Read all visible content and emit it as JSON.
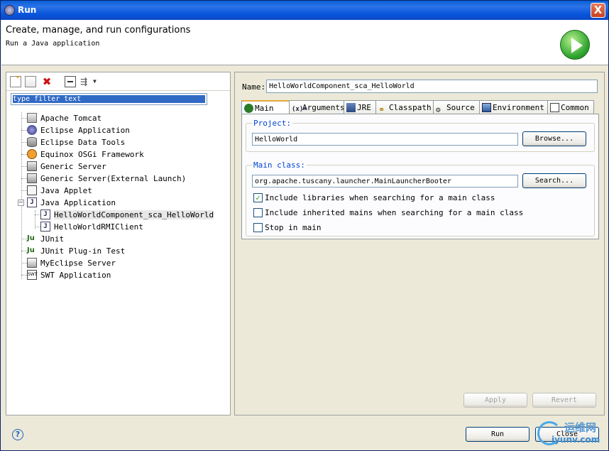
{
  "window": {
    "title": "Run",
    "close_label": "X"
  },
  "header": {
    "title": "Create, manage, and run configurations",
    "subtitle": "Run a Java application"
  },
  "left": {
    "filter_placeholder": "type filter text",
    "tree": [
      {
        "label": "Apache Tomcat",
        "icon": "tomcat-icon"
      },
      {
        "label": "Eclipse Application",
        "icon": "eclipse-icon"
      },
      {
        "label": "Eclipse Data Tools",
        "icon": "database-icon"
      },
      {
        "label": "Equinox OSGi Framework",
        "icon": "osgi-icon"
      },
      {
        "label": "Generic Server",
        "icon": "server-icon"
      },
      {
        "label": "Generic Server(External Launch)",
        "icon": "server-icon"
      },
      {
        "label": "Java Applet",
        "icon": "applet-icon"
      },
      {
        "label": "Java Application",
        "icon": "java-icon",
        "expanded": true
      },
      {
        "label": "HelloWorldComponent_sca_HelloWorld",
        "icon": "java-icon",
        "child": true,
        "selected": true
      },
      {
        "label": "HelloWorldRMIClient",
        "icon": "java-icon",
        "child": true
      },
      {
        "label": "JUnit",
        "icon": "junit-icon"
      },
      {
        "label": "JUnit Plug-in Test",
        "icon": "junit-icon"
      },
      {
        "label": "MyEclipse Server",
        "icon": "myeclipse-icon"
      },
      {
        "label": "SWT Application",
        "icon": "swt-icon"
      }
    ]
  },
  "right": {
    "name_label": "Name:",
    "name_value": "HelloWorldComponent_sca_HelloWorld",
    "tabs": [
      {
        "label": "Main",
        "icon": "main-tab-icon"
      },
      {
        "label": "Arguments",
        "icon": "arguments-icon"
      },
      {
        "label": "JRE",
        "icon": "jre-icon"
      },
      {
        "label": "Classpath",
        "icon": "classpath-icon"
      },
      {
        "label": "Source",
        "icon": "source-icon"
      },
      {
        "label": "Environment",
        "icon": "environment-icon"
      },
      {
        "label": "Common",
        "icon": "common-icon"
      }
    ],
    "project_label": "Project:",
    "project_value": "HelloWorld",
    "browse_label": "Browse...",
    "main_class_label": "Main class:",
    "main_class_value": "org.apache.tuscany.launcher.MainLauncherBooter",
    "search_label": "Search...",
    "check_include_libraries": {
      "label": "Include libraries when searching for a main class",
      "checked": true
    },
    "check_include_inherited": {
      "label": "Include inherited mains when searching for a main class",
      "checked": false
    },
    "check_stop_in_main": {
      "label": "Stop in main",
      "checked": false
    },
    "apply_label": "Apply",
    "revert_label": "Revert"
  },
  "footer": {
    "help_label": "?",
    "run_label": "Run",
    "close_label": "Close"
  },
  "watermark": {
    "line1": "运维网",
    "line2": "iyunv.com"
  },
  "colors": {
    "title_bar": "#0a5fd8",
    "link_blue": "#0046d5",
    "run_green": "#2ea42e"
  }
}
